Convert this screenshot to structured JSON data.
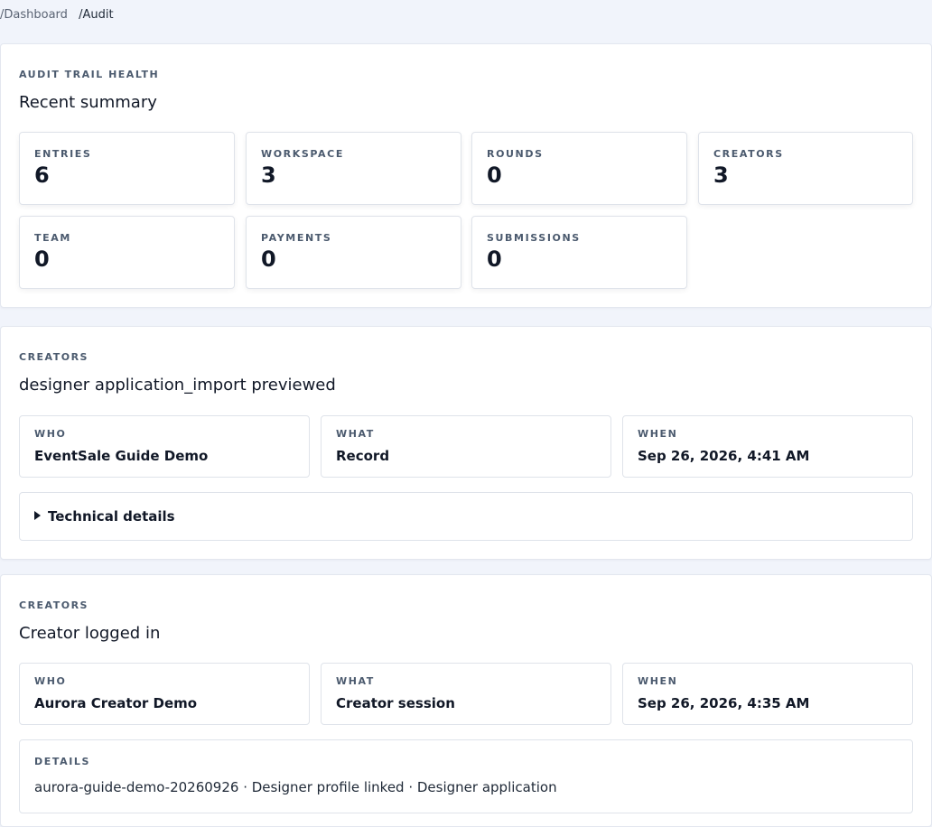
{
  "breadcrumb": {
    "parent": "/Dashboard",
    "current": "/Audit"
  },
  "summary": {
    "eyebrow": "AUDIT TRAIL HEALTH",
    "title": "Recent summary",
    "stats": [
      {
        "label": "ENTRIES",
        "value": "6"
      },
      {
        "label": "WORKSPACE",
        "value": "3"
      },
      {
        "label": "ROUNDS",
        "value": "0"
      },
      {
        "label": "CREATORS",
        "value": "3"
      },
      {
        "label": "TEAM",
        "value": "0"
      },
      {
        "label": "PAYMENTS",
        "value": "0"
      },
      {
        "label": "SUBMISSIONS",
        "value": "0"
      }
    ]
  },
  "entries": [
    {
      "category": "CREATORS",
      "title": "designer application_import previewed",
      "who_label": "WHO",
      "who": "EventSale Guide Demo",
      "what_label": "WHAT",
      "what": "Record",
      "when_label": "WHEN",
      "when": "Sep 26, 2026, 4:41 AM",
      "details_toggle": "Technical details"
    },
    {
      "category": "CREATORS",
      "title": "Creator logged in",
      "who_label": "WHO",
      "who": "Aurora Creator Demo",
      "what_label": "WHAT",
      "what": "Creator session",
      "when_label": "WHEN",
      "when": "Sep 26, 2026, 4:35 AM",
      "details_label": "DETAILS",
      "details": "aurora-guide-demo-20260926 · Designer profile linked · Designer application"
    }
  ]
}
